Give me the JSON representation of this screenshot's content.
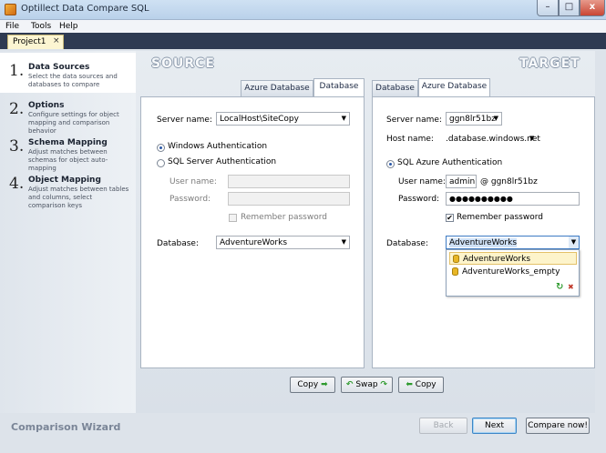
{
  "window": {
    "title": "Optillect Data Compare SQL",
    "min_glyph": "–",
    "max_glyph": "□",
    "close_glyph": "x"
  },
  "menu": [
    "File",
    "Tools",
    "Help"
  ],
  "doc_tab": {
    "label": "Project1",
    "close_glyph": "×"
  },
  "wizard": {
    "footer_title": "Comparison Wizard",
    "steps": [
      {
        "num": "1.",
        "title": "Data Sources",
        "desc": "Select the data sources and databases to compare",
        "active": true
      },
      {
        "num": "2.",
        "title": "Options",
        "desc": "Configure settings for object mapping and comparison behavior",
        "active": false
      },
      {
        "num": "3.",
        "title": "Schema Mapping",
        "desc": "Adjust matches between schemas for object auto-mapping",
        "active": false
      },
      {
        "num": "4.",
        "title": "Object Mapping",
        "desc": "Adjust matches between tables and columns, select comparison keys",
        "active": false
      }
    ]
  },
  "source": {
    "heading": "SOURCE",
    "tabs": [
      "Azure Database",
      "Database"
    ],
    "active_tab": "Database",
    "server_label": "Server name:",
    "server_value": "LocalHost\\SiteCopy",
    "auth_windows": "Windows Authentication",
    "auth_sql": "SQL Server Authentication",
    "username_label": "User name:",
    "password_label": "Password:",
    "remember_label": "Remember password",
    "database_label": "Database:",
    "database_value": "AdventureWorks"
  },
  "target": {
    "heading": "TARGET",
    "tabs": [
      "Database",
      "Azure Database"
    ],
    "active_tab": "Azure Database",
    "server_label": "Server name:",
    "server_value": "ggn8lr51bz",
    "host_label": "Host name:",
    "host_value": ".database.windows.net",
    "auth_label": "SQL Azure Authentication",
    "username_label": "User name:",
    "username_value": "admin",
    "username_suffix": "@ ggn8lr51bz",
    "password_label": "Password:",
    "password_value": "●●●●●●●●●●",
    "remember_label": "Remember password",
    "database_label": "Database:",
    "database_value": "AdventureWorks",
    "database_options": [
      "AdventureWorks",
      "AdventureWorks_empty"
    ],
    "refresh_glyph": "↻",
    "clear_glyph": "✖"
  },
  "transfer": {
    "copy_right": "Copy",
    "swap": "Swap",
    "copy_left": "Copy",
    "arrow_right": "➡",
    "arrow_left": "⬅",
    "swap_left": "↶",
    "swap_right": "↷"
  },
  "footer": {
    "back": "Back",
    "next": "Next",
    "compare": "Compare now!"
  },
  "colors": {
    "accent": "#2e3a52",
    "tab_active": "#fcf5d2",
    "check_green": "#2e9a2e"
  }
}
